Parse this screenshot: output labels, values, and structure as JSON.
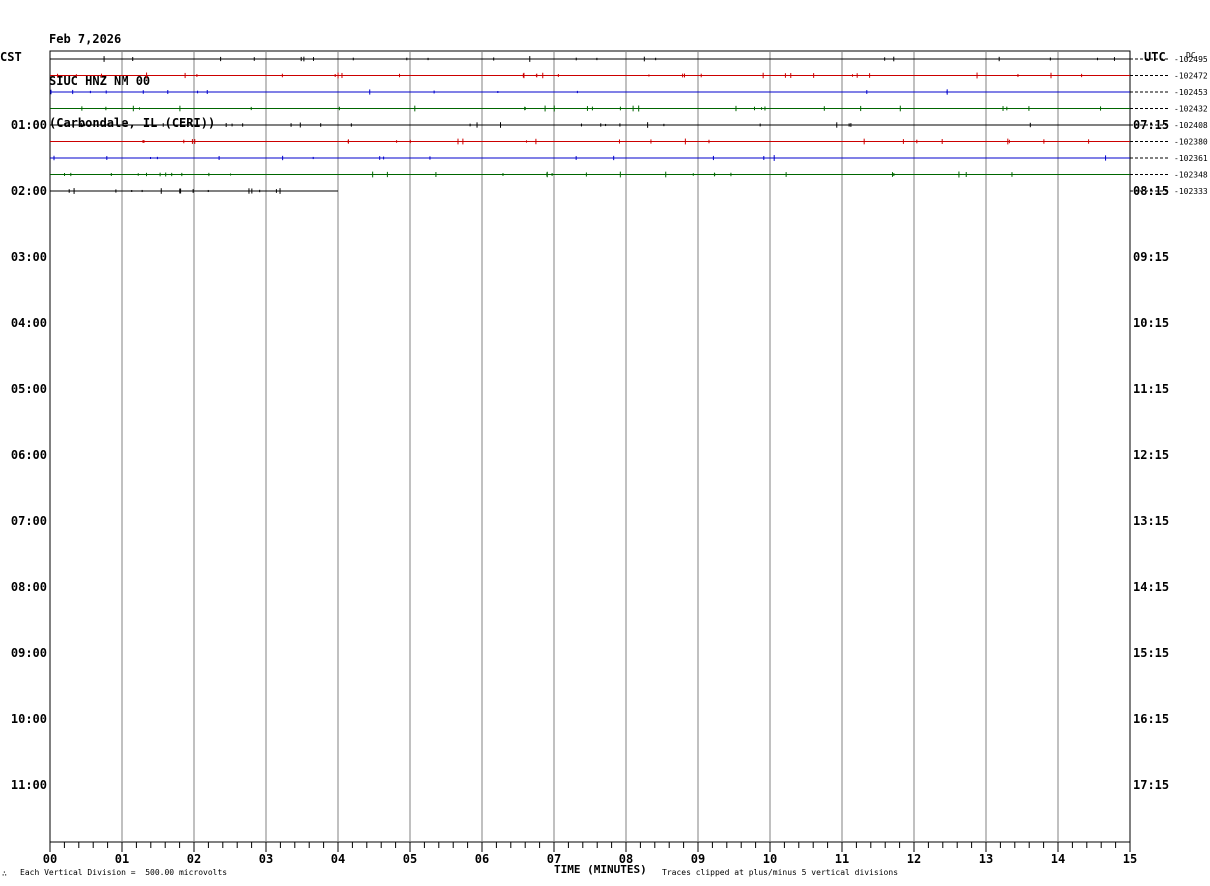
{
  "header": {
    "date": "Feb 7,2026",
    "station": "SIUC HNZ NM 00",
    "location": "(Carbondale, IL (CERI))"
  },
  "left_tz": "CST",
  "right_tz": "UTC",
  "dc_label": "DC",
  "footer": {
    "scale_note": "Each Vertical Division =  500.00 microvolts",
    "xaxis_title": "TIME (MINUTES)",
    "clip_note": "Traces clipped at plus/minus 5 vertical divisions",
    "corner_mark": "∴"
  },
  "colors": {
    "black": "#000000",
    "red": "#cc0000",
    "blue": "#0000cc",
    "green": "#006600",
    "grid": "#808080"
  },
  "chart_data": {
    "type": "line",
    "xlabel": "TIME (MINUTES)",
    "xlim": [
      0,
      15
    ],
    "x_ticks": [
      "00",
      "01",
      "02",
      "03",
      "04",
      "05",
      "06",
      "07",
      "08",
      "09",
      "10",
      "11",
      "12",
      "13",
      "14",
      "15"
    ],
    "left_hour_labels": [
      "01:00",
      "02:00",
      "03:00",
      "04:00",
      "05:00",
      "06:00",
      "07:00",
      "08:00",
      "09:00",
      "10:00",
      "11:00"
    ],
    "right_hour_labels": [
      "07:15",
      "08:15",
      "09:15",
      "10:15",
      "11:15",
      "12:15",
      "13:15",
      "14:15",
      "15:15",
      "16:15",
      "17:15"
    ],
    "trace_color_cycle": [
      "black",
      "red",
      "blue",
      "green"
    ],
    "traces": [
      {
        "dc": "-102495",
        "color": "black",
        "end_minute": 15
      },
      {
        "dc": "-102472",
        "color": "red",
        "end_minute": 15
      },
      {
        "dc": "-102453",
        "color": "blue",
        "end_minute": 15
      },
      {
        "dc": "-102432",
        "color": "green",
        "end_minute": 15
      },
      {
        "dc": "-102408",
        "color": "black",
        "end_minute": 15
      },
      {
        "dc": "-102380",
        "color": "red",
        "end_minute": 15
      },
      {
        "dc": "-102361",
        "color": "blue",
        "end_minute": 15
      },
      {
        "dc": "-102348",
        "color": "green",
        "end_minute": 15
      },
      {
        "dc": "-102333",
        "color": "black",
        "end_minute": 4
      }
    ]
  }
}
